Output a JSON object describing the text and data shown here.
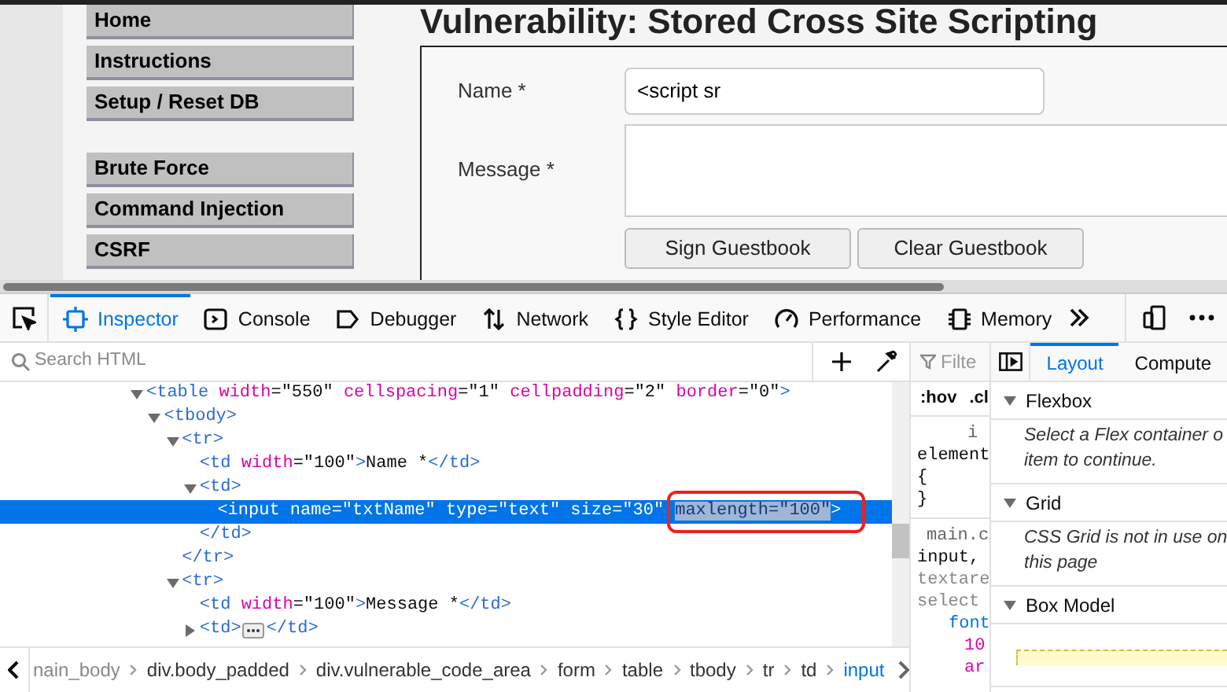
{
  "page": {
    "sidebar": {
      "groups": [
        {
          "items": [
            "Home",
            "Instructions",
            "Setup / Reset DB"
          ]
        },
        {
          "items": [
            "Brute Force",
            "Command Injection",
            "CSRF"
          ]
        }
      ]
    },
    "heading": "Vulnerability: Stored Cross Site Scripting",
    "form": {
      "name_label": "Name *",
      "name_value": "<script sr",
      "message_label": "Message *",
      "buttons": [
        "Sign Guestbook",
        "Clear Guestbook"
      ]
    }
  },
  "devtools": {
    "tabs": [
      {
        "kind": "inspector",
        "label": "Inspector",
        "selected": true
      },
      {
        "kind": "console",
        "label": "Console",
        "selected": false
      },
      {
        "kind": "debugger",
        "label": "Debugger",
        "selected": false
      },
      {
        "kind": "network",
        "label": "Network",
        "selected": false
      },
      {
        "kind": "style",
        "label": "Style Editor",
        "selected": false
      },
      {
        "kind": "performance",
        "label": "Performance",
        "selected": false
      },
      {
        "kind": "memory",
        "label": "Memory",
        "selected": false
      }
    ],
    "search": {
      "placeholder": "Search HTML"
    },
    "tree": [
      {
        "line": "<table width=\"550\" cellspacing=\"1\" cellpadding=\"2\" border=\"0\">",
        "expanded": true,
        "selected": false,
        "children": [
          {
            "line": "<tbody>",
            "expanded": true,
            "selected": false,
            "children": [
              {
                "line": "<tr>",
                "expanded": true,
                "selected": false,
                "children": [
                  {
                    "line": "<td width=\"100\">Name *</td>",
                    "selected": false
                  },
                  {
                    "line": "<td>",
                    "expanded": true,
                    "selected": false,
                    "children": [
                      {
                        "line": "<input name=\"txtName\" type=\"text\" size=\"30\"",
                        "highlight": "maxlength=\"100\"",
                        "after": ">",
                        "selected": true
                      }
                    ]
                  },
                  {
                    "line": "</td>",
                    "selected": false
                  }
                ]
              },
              {
                "line": "</tr>",
                "selected": false
              },
              {
                "line": "<tr>",
                "expanded": true,
                "selected": false,
                "children": [
                  {
                    "line": "<td width=\"100\">Message *</td>",
                    "selected": false
                  },
                  {
                    "line": "<td>",
                    "expanded": false,
                    "after": "</td>",
                    "selected": false
                  }
                ]
              }
            ]
          }
        ]
      }
    ],
    "breadcrumbs": [
      {
        "label": "nain_body",
        "selected": false
      },
      {
        "label": "div.body_padded",
        "selected": false
      },
      {
        "label": "div.vulnerable_code_area",
        "selected": false
      },
      {
        "label": "form",
        "selected": false
      },
      {
        "label": "table",
        "selected": false
      },
      {
        "label": "tbody",
        "selected": false
      },
      {
        "label": "tr",
        "selected": false
      },
      {
        "label": "td",
        "selected": false
      },
      {
        "label": "input",
        "selected": true
      }
    ],
    "rules": {
      "filter_placeholder": "Filte",
      "pseudo": ":hov",
      "cls": ".cl",
      "lines": [
        "i",
        "element",
        "{",
        "}"
      ],
      "source": "main.c",
      "selector_lines": [
        "input,",
        "textare",
        "select"
      ],
      "property": "font",
      "values": [
        "10",
        "ar"
      ]
    },
    "layout": {
      "tabs": [
        {
          "label": "Layout",
          "selected": true
        },
        {
          "label": "Compute",
          "selected": false
        }
      ],
      "sections": [
        {
          "title": "Flexbox",
          "expanded": true,
          "lines": [
            "Select a Flex container o",
            "item to continue."
          ]
        },
        {
          "title": "Grid",
          "expanded": true,
          "lines": [
            "CSS Grid is not in use on",
            "this page"
          ]
        },
        {
          "title": "Box Model",
          "expanded": true
        }
      ]
    }
  }
}
